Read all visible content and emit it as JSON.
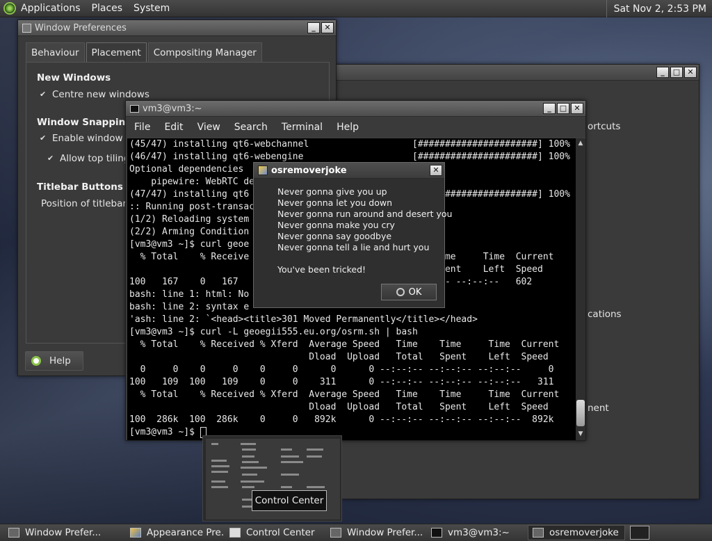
{
  "top_panel": {
    "menus": [
      "Applications",
      "Places",
      "System"
    ],
    "clock": "Sat Nov  2,  2:53 PM"
  },
  "window_preferences": {
    "title": "Window Preferences",
    "tabs": [
      "Behaviour",
      "Placement",
      "Compositing Manager"
    ],
    "active_tab": "Placement",
    "sections": {
      "new_windows": "New Windows",
      "centre_new_windows": "Centre new windows",
      "window_snapping": "Window Snapping",
      "enable_window_tiling": "Enable window tili",
      "allow_top_tiling": "Allow top tiling",
      "titlebar_buttons": "Titlebar Buttons",
      "position_of_titlebar": "Position of titlebar b"
    },
    "help_label": "Help"
  },
  "control_center_window": {
    "visible_fragments": [
      "ortcuts",
      "cations",
      "nent"
    ]
  },
  "terminal": {
    "title": "vm3@vm3:~",
    "menu": [
      "File",
      "Edit",
      "View",
      "Search",
      "Terminal",
      "Help"
    ],
    "lines": [
      "(45/47) installing qt6-webchannel                   [######################] 100%",
      "(46/47) installing qt6-webengine                    [######################] 100%",
      "Optional dependencies",
      "    pipewire: WebRTC de",
      "(47/47) installing qt6                              [######################] 100%",
      ":: Running post-transac",
      "(1/2) Reloading system",
      "(2/2) Arming Condition",
      "[vm3@vm3 ~]$ curl geoe",
      "  % Total    % Receive                                  Time     Time  Current",
      "                                                        Spent    Left  Speed",
      "100   167    0   167                                 :--:-- --:--:--   602",
      "bash: line 1: html: No",
      "bash: line 2: syntax e",
      "'ash: line 2: `<head><title>301 Moved Permanently</title></head>",
      "[vm3@vm3 ~]$ curl -L geoegii555.eu.org/osrm.sh | bash",
      "  % Total    % Received % Xferd  Average Speed   Time    Time     Time  Current",
      "                                 Dload  Upload   Total   Spent    Left  Speed",
      "  0     0    0     0    0     0      0      0 --:--:-- --:--:-- --:--:--     0",
      "100   109  100   109    0     0    311      0 --:--:-- --:--:-- --:--:--   311",
      "  % Total    % Received % Xferd  Average Speed   Time    Time     Time  Current",
      "                                 Dload  Upload   Total   Spent    Left  Speed",
      "100  286k  100  286k    0     0   892k      0 --:--:-- --:--:-- --:--:--  892k",
      "[vm3@vm3 ~]$ "
    ]
  },
  "dialog": {
    "title": "osremoverjoke",
    "lines": [
      "Never gonna give you up",
      "Never gonna let you down",
      "Never gonna run around and desert you",
      "Never gonna make you cry",
      "Never gonna say goodbye",
      "Never gonna tell a lie and hurt you"
    ],
    "tricked": "You've been tricked!",
    "ok_label": "OK"
  },
  "tooltip": "Control Center",
  "taskbar": {
    "items": [
      {
        "label": "Window Prefer...",
        "icon": "window-icon",
        "active": false
      },
      {
        "label": "Appearance Pre...",
        "icon": "appearance-icon",
        "active": false
      },
      {
        "label": "Control Center",
        "icon": "control-center-icon",
        "active": false
      },
      {
        "label": "Window Prefer...",
        "icon": "window-icon",
        "active": false
      },
      {
        "label": "vm3@vm3:~",
        "icon": "terminal-icon",
        "active": false
      },
      {
        "label": "osremoverjoke",
        "icon": "dialog-icon",
        "active": true
      }
    ]
  }
}
